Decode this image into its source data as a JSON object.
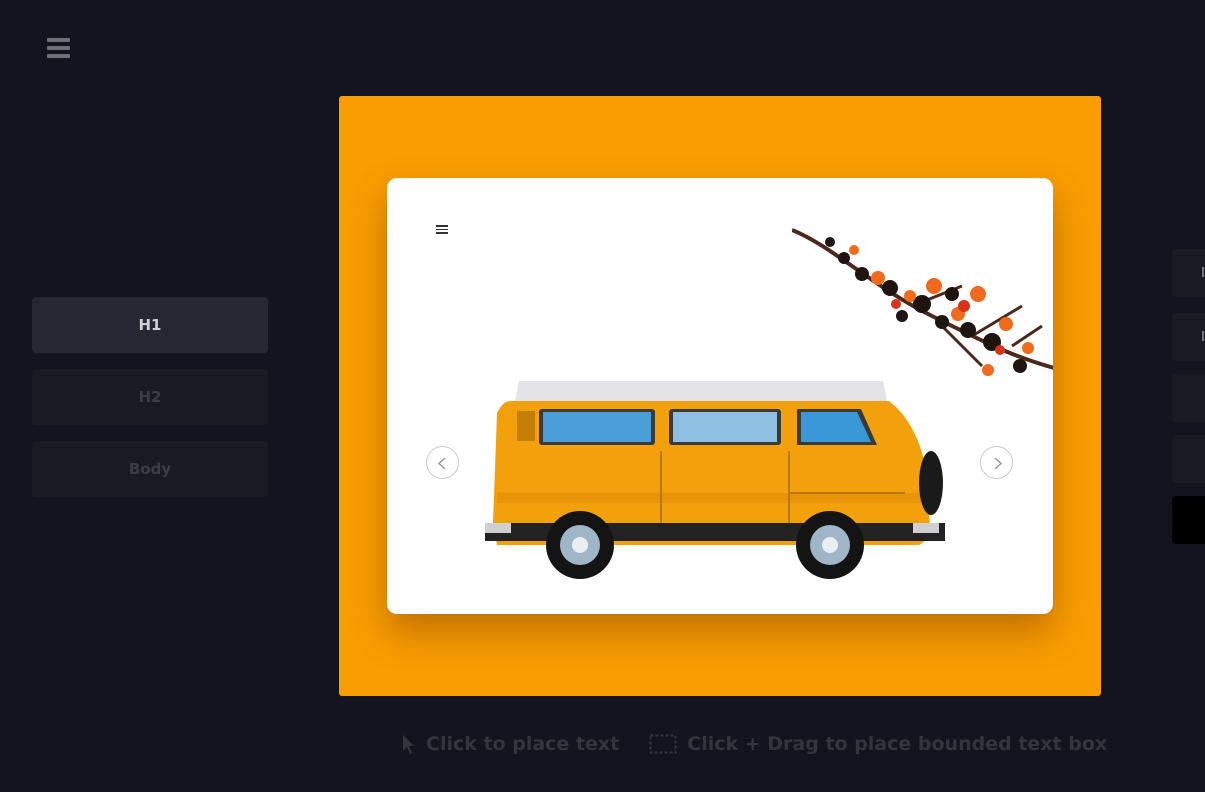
{
  "sidebar": {
    "menu_icon": "hamburger-icon",
    "text_styles": [
      "H1",
      "H2",
      "Body"
    ],
    "active_style": "H1"
  },
  "canvas": {
    "background": "#f99d00",
    "card": {
      "menu_icon": "hamburger-icon",
      "prev_icon": "chevron-left-icon",
      "next_icon": "chevron-right-icon",
      "image": "van-and-flowers-photo"
    }
  },
  "hints": {
    "click_icon": "cursor-icon",
    "click_text": "Click to place text",
    "drag_icon": "dashed-box-icon",
    "drag_text": "Click + Drag to place bounded text box"
  },
  "colors": {
    "app_bg": "#14141f",
    "accent": "#f99d00"
  }
}
